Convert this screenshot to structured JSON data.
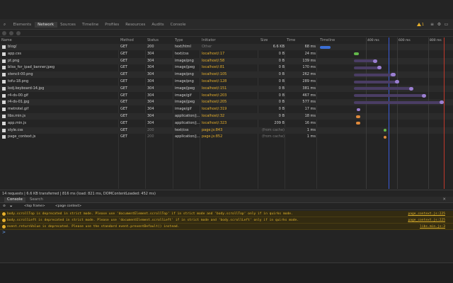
{
  "tabs": [
    "Elements",
    "Network",
    "Sources",
    "Timeline",
    "Profiles",
    "Resources",
    "Audits",
    "Console"
  ],
  "active_tab": "Network",
  "warnings_count": "1",
  "network": {
    "columns": [
      "Name",
      "Method",
      "Status",
      "Type",
      "Initiator",
      "Size",
      "Time",
      "Timeline"
    ],
    "tick_labels": [
      "400 ms",
      "600 ms",
      "800 ms"
    ],
    "rows": [
      {
        "name": "blog/",
        "method": "GET",
        "status": "200",
        "type": "text/html",
        "initiator": "Other",
        "size": "6.6 KB",
        "time": "68 ms"
      },
      {
        "name": "app.css",
        "method": "GET",
        "status": "304",
        "type": "text/css",
        "initiator": "localhost/:17",
        "size": "0 B",
        "time": "24 ms"
      },
      {
        "name": "pt.png",
        "method": "GET",
        "status": "304",
        "type": "image/png",
        "initiator": "localhost/:58",
        "size": "0 B",
        "time": "139 ms"
      },
      {
        "name": "bliss_for_ipad_banner.jpeg",
        "method": "GET",
        "status": "304",
        "type": "image/jpeg",
        "initiator": "localhost/:81",
        "size": "0 B",
        "time": "170 ms"
      },
      {
        "name": "stencil-00.png",
        "method": "GET",
        "status": "304",
        "type": "image/png",
        "initiator": "localhost/:105",
        "size": "0 B",
        "time": "262 ms"
      },
      {
        "name": "tofu-18.png",
        "method": "GET",
        "status": "304",
        "type": "image/png",
        "initiator": "localhost/:128",
        "size": "0 B",
        "time": "289 ms"
      },
      {
        "name": "lodj.keyboard-14.jpg",
        "method": "GET",
        "status": "304",
        "type": "image/jpeg",
        "initiator": "localhost/:151",
        "size": "0 B",
        "time": "381 ms"
      },
      {
        "name": "r4-ds-00.gif",
        "method": "GET",
        "status": "304",
        "type": "image/gif",
        "initiator": "localhost/:203",
        "size": "0 B",
        "time": "467 ms"
      },
      {
        "name": "r4-ds-01.jpg",
        "method": "GET",
        "status": "304",
        "type": "image/jpeg",
        "initiator": "localhost/:205",
        "size": "0 B",
        "time": "577 ms"
      },
      {
        "name": "metrotel.gif",
        "method": "GET",
        "status": "304",
        "type": "image/gif",
        "initiator": "localhost/:319",
        "size": "0 B",
        "time": "17 ms"
      },
      {
        "name": "libs.min.js",
        "method": "GET",
        "status": "304",
        "type": "application/j...",
        "initiator": "localhost/:32",
        "size": "0 B",
        "time": "18 ms"
      },
      {
        "name": "app.min.js",
        "method": "GET",
        "status": "304",
        "type": "application/j...",
        "initiator": "localhost/:323",
        "size": "209 B",
        "time": "16 ms"
      },
      {
        "name": "style.css",
        "method": "GET",
        "status": "200",
        "type": "text/css",
        "initiator": "page.js:843",
        "size": "(from cache)",
        "time": "1 ms"
      },
      {
        "name": "page_context.js",
        "method": "GET",
        "status": "200",
        "type": "application/j...",
        "initiator": "page.js:852",
        "size": "(from cache)",
        "time": "1 ms"
      }
    ],
    "summary": "14 requests  |  6.6 KB transferred  |  816 ms (load: 821 ms, DOMContentLoaded: 452 ms)"
  },
  "console": {
    "tabs": [
      "Console",
      "Search"
    ],
    "frame_select": "<top frame>",
    "context_select": "<page context>",
    "messages": [
      {
        "text": "body.scrollTop is deprecated in strict mode. Please use 'documentElement.scrollTop' if in strict mode and 'body.scrollTop' only if in quirks mode.",
        "source": "page_context.js:225"
      },
      {
        "text": "body.scrollLeft is deprecated in strict mode. Please use 'documentElement.scrollLeft' if in strict mode and 'body.scrollLeft' only if in quirks mode.",
        "source": "page_context.js:225"
      },
      {
        "text": "event.returnValue is deprecated. Please use the standard event.preventDefault() instead.",
        "source": "libs.min.js:3"
      }
    ],
    "prompt": ">"
  },
  "colors": {
    "accent": "#e7b02c",
    "bar_wait": "#4a3d64",
    "bar_receive": "#9b7fd1",
    "dom_line": "#3b5bdb",
    "load_line": "#c0392b"
  }
}
